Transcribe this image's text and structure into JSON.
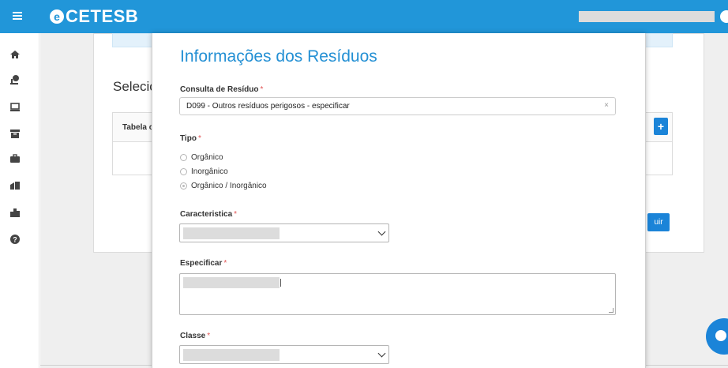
{
  "header": {
    "logo_text": "CETESB",
    "logo_mark": "e"
  },
  "sidebar": {
    "items": [
      {
        "icon": "home-icon"
      },
      {
        "icon": "person-location-icon"
      },
      {
        "icon": "monitor-icon"
      },
      {
        "icon": "archive-icon"
      },
      {
        "icon": "briefcase-icon"
      },
      {
        "icon": "building-icon"
      },
      {
        "icon": "city-icon"
      },
      {
        "icon": "help-icon"
      }
    ]
  },
  "background": {
    "section_title": "Selecio",
    "table_header": "Tabela c",
    "add_button": "+",
    "action_button": "uir"
  },
  "modal": {
    "title": "Informações dos Resíduos",
    "consulta": {
      "label": "Consulta de Resíduo",
      "required": "*",
      "value": "D099 - Outros resíduos perigosos - especificar",
      "clear": "×"
    },
    "tipo": {
      "label": "Tipo",
      "required": "*",
      "options": [
        "Orgânico",
        "Inorgânico",
        "Orgânico / Inorgânico"
      ],
      "selected": "Orgânico / Inorgânico"
    },
    "caracteristica": {
      "label": "Caracteristica",
      "required": "*"
    },
    "especificar": {
      "label": "Especificar",
      "required": "*"
    },
    "classe": {
      "label": "Classe",
      "required": "*"
    }
  },
  "colors": {
    "primary": "#2196d9",
    "title": "#2490d4",
    "required": "#e25555"
  }
}
